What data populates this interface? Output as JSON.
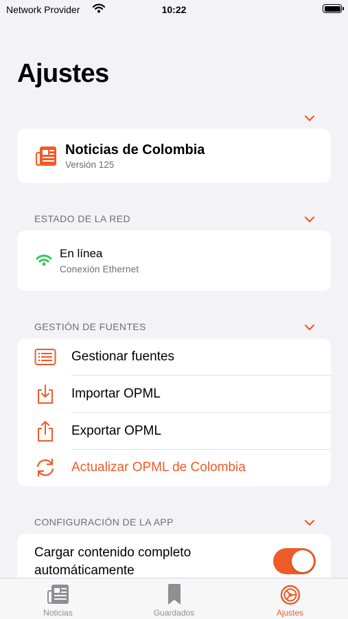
{
  "status_bar": {
    "carrier": "Network Provider",
    "time": "10:22"
  },
  "page": {
    "title": "Ajustes"
  },
  "app_info": {
    "name": "Noticias de Colombia",
    "version": "Versión 125"
  },
  "network": {
    "header": "ESTADO DE LA RED",
    "status": "En línea",
    "detail": "Conexión Ethernet"
  },
  "sources": {
    "header": "GESTIÓN DE FUENTES",
    "items": [
      {
        "label": "Gestionar fuentes",
        "icon": "list-icon"
      },
      {
        "label": "Importar OPML",
        "icon": "import-icon"
      },
      {
        "label": "Exportar OPML",
        "icon": "export-icon"
      },
      {
        "label": "Actualizar OPML de Colombia",
        "icon": "refresh-icon"
      }
    ]
  },
  "app_config": {
    "header": "CONFIGURACIÓN DE LA APP",
    "full_content_label": "Cargar contenido completo automáticamente",
    "full_content_enabled": true
  },
  "tab_bar": {
    "tabs": [
      {
        "label": "Noticias",
        "icon": "newspaper-icon",
        "active": false
      },
      {
        "label": "Guardados",
        "icon": "bookmark-icon",
        "active": false
      },
      {
        "label": "Ajustes",
        "icon": "settings-icon",
        "active": true
      }
    ]
  },
  "colors": {
    "accent": "#f05a28",
    "online": "#34c759",
    "background": "#f2f2f7"
  }
}
